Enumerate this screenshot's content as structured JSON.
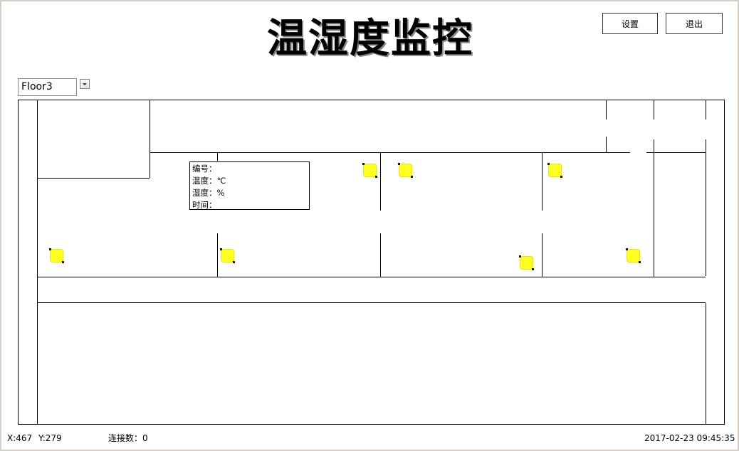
{
  "header": {
    "title": "温湿度监控",
    "settings_label": "设置",
    "exit_label": "退出"
  },
  "floor_select": {
    "value": "Floor3"
  },
  "sensors": [
    {
      "id": "sensor-1"
    },
    {
      "id": "sensor-2"
    },
    {
      "id": "sensor-3"
    },
    {
      "id": "sensor-4"
    },
    {
      "id": "sensor-5"
    },
    {
      "id": "sensor-6"
    },
    {
      "id": "sensor-7"
    },
    {
      "id": "sensor-8"
    }
  ],
  "info_popup": {
    "id_line": "编号：",
    "temp_line": "温度：℃",
    "humidity_line": "湿度：%",
    "time_line": "时间："
  },
  "status_bar": {
    "x": "X:467",
    "y": "Y:279",
    "connections": "连接数：0",
    "datetime": "2017-02-23   09:45:35"
  },
  "colors": {
    "sensor": "#ffff22",
    "line": "#000000",
    "frame": "#d8cfc3"
  }
}
